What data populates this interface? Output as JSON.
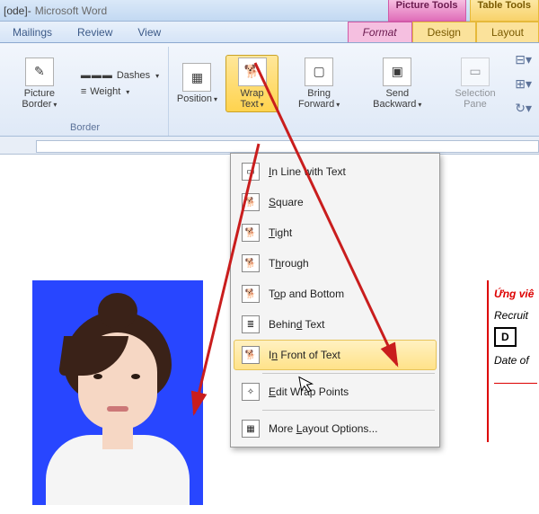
{
  "titlebar": {
    "doc": "[ode]",
    "sep": " - ",
    "app": "Microsoft Word"
  },
  "contextual": {
    "picture": "Picture Tools",
    "table": "Table Tools"
  },
  "tabs": {
    "mailings": "Mailings",
    "review": "Review",
    "view": "View",
    "format": "Format",
    "design": "Design",
    "layout": "Layout"
  },
  "ribbon": {
    "border_group": "Border",
    "picture_border": "Picture Border",
    "dashes": "Dashes",
    "weight": "Weight",
    "position": "Position",
    "wrap_text": "Wrap Text",
    "bring_forward": "Bring Forward",
    "send_backward": "Send Backward",
    "selection_pane": "Selection Pane"
  },
  "menu": {
    "inline": "In Line with Text",
    "square": "Square",
    "tight": "Tight",
    "through": "Through",
    "topbottom": "Top and Bottom",
    "behind": "Behind Text",
    "front": "In Front of Text",
    "edit": "Edit Wrap Points",
    "more": "More Layout Options..."
  },
  "docbox": {
    "t1": "Ứng viê",
    "t2": "Recruit",
    "t3": "D",
    "t4": "Date of"
  }
}
